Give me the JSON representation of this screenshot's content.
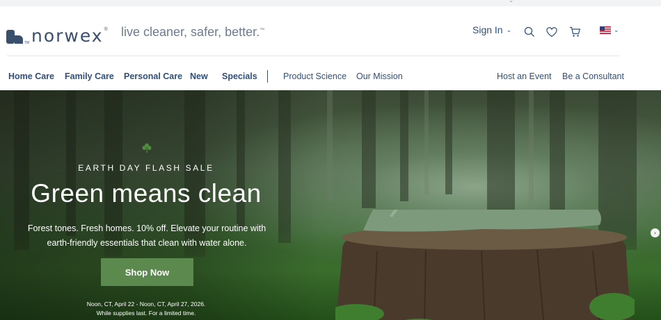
{
  "header": {
    "logo_text": "norwex",
    "logo_tm": "®",
    "tagline": "live cleaner, safer, better.",
    "tagline_tm": "™",
    "sign_in_label": "Sign In",
    "icons": [
      "chevron-down-icon",
      "search-icon",
      "heart-icon",
      "cart-icon",
      "us-flag-icon"
    ]
  },
  "nav": {
    "primary": [
      "Home Care",
      "Family Care",
      "Personal Care",
      "New",
      "Specials"
    ],
    "secondary": [
      "Product Science",
      "Our Mission"
    ],
    "right": [
      "Host an Event",
      "Be a Consultant"
    ]
  },
  "hero": {
    "eyebrow": "EARTH DAY FLASH SALE",
    "headline": "Green means clean",
    "body_line1": "Forest tones. Fresh homes. 10% off. Elevate your routine with",
    "body_line2": "earth-friendly essentials that clean with water alone.",
    "cta_label": "Shop Now",
    "fine_print_line1": "Noon, CT, April 22 - Noon, CT, April 27, 2026.",
    "fine_print_line2": "While supplies last. For a limited time.",
    "next_arrow": "›"
  },
  "colors": {
    "brand_navy": "#3a4f6e",
    "nav_text": "#2f4f7a",
    "cta_green": "#5c8a4e"
  }
}
